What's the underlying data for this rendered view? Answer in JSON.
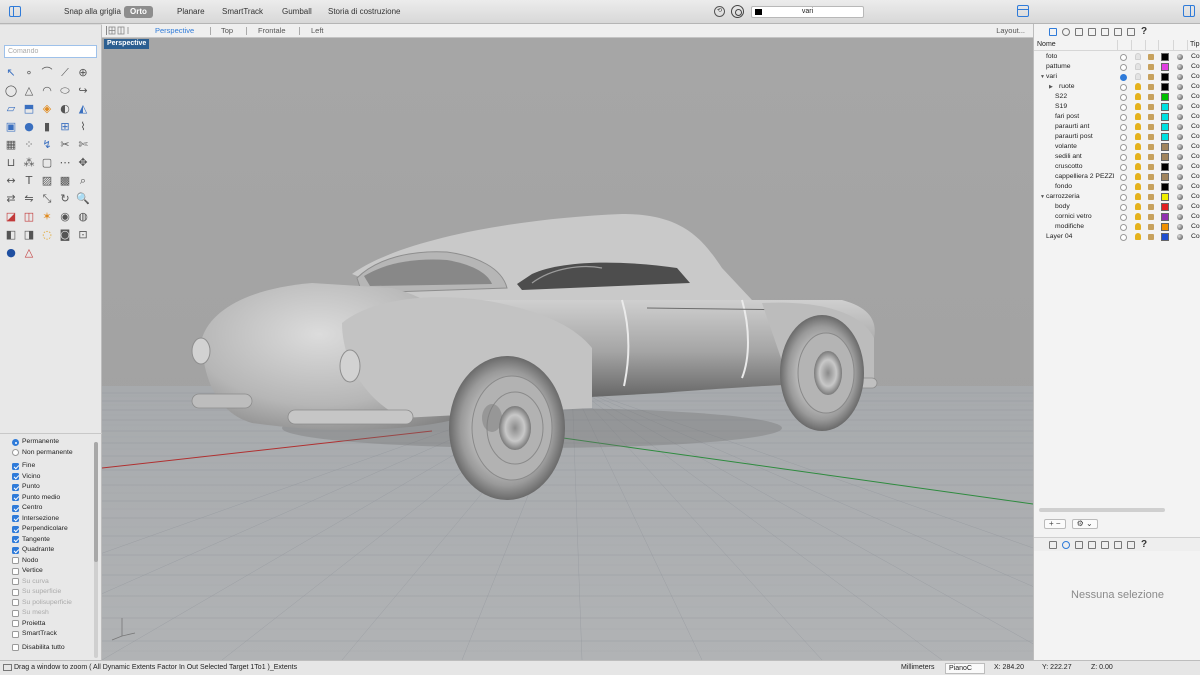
{
  "topbar": {
    "toggles": [
      {
        "label": "Snap alla griglia",
        "on": false
      },
      {
        "label": "Orto",
        "on": true
      },
      {
        "label": "Planare",
        "on": false
      },
      {
        "label": "SmartTrack",
        "on": false
      },
      {
        "label": "Gumball",
        "on": false
      },
      {
        "label": "Storia di costruzione",
        "on": false
      }
    ],
    "osnap_icon_glyph": "⟲",
    "current_layer": "vari",
    "current_layer_color": "#000000"
  },
  "command": {
    "placeholder": "Comando"
  },
  "toolbox_icons": [
    "select-arrow-icon",
    "point-icon",
    "polyline-icon",
    "curve-control-points-icon",
    "zoom-extents-icon",
    "circle-icon",
    "polygon-icon",
    "arc-icon",
    "ellipse-icon",
    "fillet-curve-icon",
    "plane-surface-icon",
    "extrude-surface-icon",
    "loft-icon",
    "revolve-icon",
    "sweep-icon",
    "box-solid-icon",
    "sphere-icon",
    "cylinder-icon",
    "boolean-union-icon",
    "blend-icon",
    "mesh-icon",
    "edit-points-icon",
    "curve-from-object-icon",
    "split-icon",
    "trim-icon",
    "join-icon",
    "explode-icon",
    "group-icon",
    "array-icon",
    "move-icon",
    "dimension-icon",
    "text-icon",
    "hatch-icon",
    "block-icon",
    "analyze-icon",
    "transform-icon",
    "mirror-icon",
    "scale-icon",
    "rotate-icon",
    "zoom-icon",
    "render-icon",
    "camera-icon",
    "light-icon",
    "material-icon",
    "environment-icon",
    "shaded-view-icon",
    "section-icon",
    "color-wheel-icon",
    "snapshot-icon",
    "grid-icon",
    "sphere-render-icon",
    "paint-icon"
  ],
  "osnap": {
    "mode_options": [
      {
        "label": "Permanente",
        "selected": true
      },
      {
        "label": "Non permanente",
        "selected": false
      }
    ],
    "snaps": [
      {
        "label": "Fine",
        "checked": true,
        "enabled": true
      },
      {
        "label": "Vicino",
        "checked": true,
        "enabled": true
      },
      {
        "label": "Punto",
        "checked": true,
        "enabled": true
      },
      {
        "label": "Punto medio",
        "checked": true,
        "enabled": true
      },
      {
        "label": "Centro",
        "checked": true,
        "enabled": true
      },
      {
        "label": "Intersezione",
        "checked": true,
        "enabled": true
      },
      {
        "label": "Perpendicolare",
        "checked": true,
        "enabled": true
      },
      {
        "label": "Tangente",
        "checked": true,
        "enabled": true
      },
      {
        "label": "Quadrante",
        "checked": true,
        "enabled": true
      },
      {
        "label": "Nodo",
        "checked": false,
        "enabled": true
      },
      {
        "label": "Vertice",
        "checked": false,
        "enabled": true
      },
      {
        "label": "Su curva",
        "checked": false,
        "enabled": false
      },
      {
        "label": "Su superficie",
        "checked": false,
        "enabled": false
      },
      {
        "label": "Su polisuperficie",
        "checked": false,
        "enabled": false
      },
      {
        "label": "Su mesh",
        "checked": false,
        "enabled": false
      },
      {
        "label": "Proietta",
        "checked": false,
        "enabled": true
      },
      {
        "label": "SmartTrack",
        "checked": false,
        "enabled": true
      }
    ],
    "disable_all": "Disabilita tutto"
  },
  "viewport_tabs": {
    "tabs": [
      {
        "label": "Perspective",
        "active": true
      },
      {
        "label": "Top",
        "active": false
      },
      {
        "label": "Frontale",
        "active": false
      },
      {
        "label": "Left",
        "active": false
      }
    ],
    "layout_label": "Layout..."
  },
  "viewport": {
    "title": "Perspective",
    "axes": {
      "x_color": "#b03030",
      "y_color": "#2e8b3e"
    }
  },
  "layers_panel": {
    "col_name": "Nome",
    "col_type": "Tip",
    "rows": [
      {
        "name": "foto",
        "level": 0,
        "expander": "",
        "current": false,
        "visible": false,
        "color": "#000000",
        "tipo": "Co"
      },
      {
        "name": "pattume",
        "level": 0,
        "expander": "",
        "current": false,
        "visible": false,
        "color": "#e040e0",
        "tipo": "Co"
      },
      {
        "name": "vari",
        "level": 0,
        "expander": "▼",
        "current": true,
        "visible": false,
        "color": "#000000",
        "tipo": "Co"
      },
      {
        "name": "ruote",
        "level": 1,
        "expander": "▶",
        "current": false,
        "visible": true,
        "color": "#000000",
        "tipo": "Co"
      },
      {
        "name": "S22",
        "level": 1,
        "expander": "",
        "current": false,
        "visible": true,
        "color": "#00c000",
        "tipo": "Co"
      },
      {
        "name": "S19",
        "level": 1,
        "expander": "",
        "current": false,
        "visible": true,
        "color": "#00e0e0",
        "tipo": "Co"
      },
      {
        "name": "fari post",
        "level": 1,
        "expander": "",
        "current": false,
        "visible": true,
        "color": "#00e0e0",
        "tipo": "Co"
      },
      {
        "name": "paraurti ant",
        "level": 1,
        "expander": "",
        "current": false,
        "visible": true,
        "color": "#00e0e0",
        "tipo": "Co"
      },
      {
        "name": "paraurti post",
        "level": 1,
        "expander": "",
        "current": false,
        "visible": true,
        "color": "#00e0e0",
        "tipo": "Co"
      },
      {
        "name": "volante",
        "level": 1,
        "expander": "",
        "current": false,
        "visible": true,
        "color": "#a0845c",
        "tipo": "Co"
      },
      {
        "name": "sedili ant",
        "level": 1,
        "expander": "",
        "current": false,
        "visible": true,
        "color": "#a0845c",
        "tipo": "Co"
      },
      {
        "name": "cruscotto",
        "level": 1,
        "expander": "",
        "current": false,
        "visible": true,
        "color": "#000000",
        "tipo": "Co"
      },
      {
        "name": "cappelliera 2 PEZZI",
        "level": 1,
        "expander": "",
        "current": false,
        "visible": true,
        "color": "#a0845c",
        "tipo": "Co"
      },
      {
        "name": "fondo",
        "level": 1,
        "expander": "",
        "current": false,
        "visible": true,
        "color": "#000000",
        "tipo": "Co"
      },
      {
        "name": "carrozzeria",
        "level": 0,
        "expander": "▼",
        "current": false,
        "visible": true,
        "color": "#f0f000",
        "tipo": "Co"
      },
      {
        "name": "body",
        "level": 1,
        "expander": "",
        "current": false,
        "visible": true,
        "color": "#e02020",
        "tipo": "Co"
      },
      {
        "name": "cornici vetro",
        "level": 1,
        "expander": "",
        "current": false,
        "visible": true,
        "color": "#9030b0",
        "tipo": "Co"
      },
      {
        "name": "modifiche",
        "level": 1,
        "expander": "",
        "current": false,
        "visible": true,
        "color": "#f09000",
        "tipo": "Co"
      },
      {
        "name": "Layer 04",
        "level": 0,
        "expander": "",
        "current": false,
        "visible": true,
        "color": "#1f4fd0",
        "tipo": "Co"
      }
    ],
    "add_label": "+",
    "remove_label": "−",
    "gear_label": "⚙ ⌄"
  },
  "properties_panel": {
    "empty_text": "Nessuna selezione"
  },
  "statusbar": {
    "prompt": "Drag a window to zoom ( All Dynamic Extents Factor In Out Selected Target 1To1 )_Extents",
    "units": "Millimeters",
    "plane": "PianoC",
    "x": "X: 284.20",
    "y": "Y: 222.27",
    "z": "Z: 0.00"
  }
}
